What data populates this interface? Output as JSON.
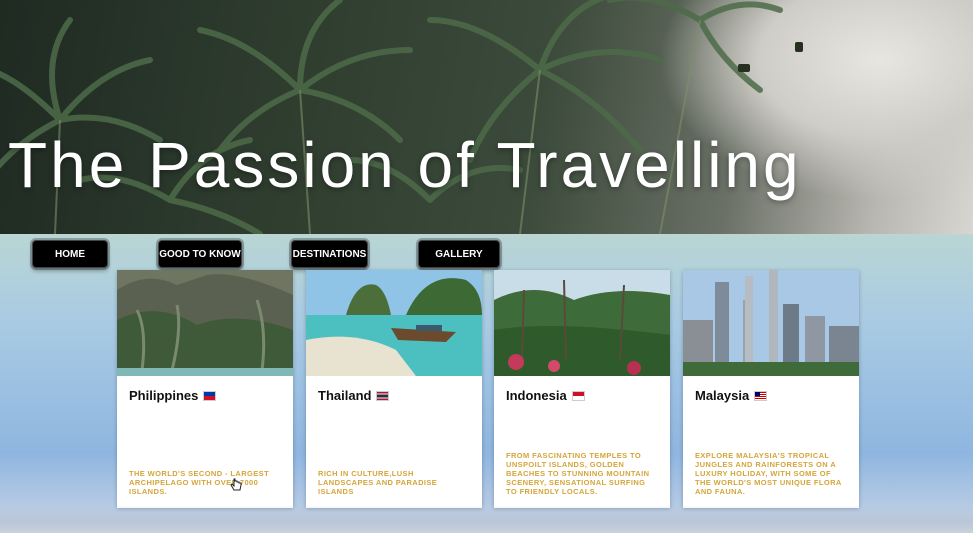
{
  "hero": {
    "title": "The Passion of Travelling"
  },
  "nav": {
    "items": [
      {
        "label": "HOME"
      },
      {
        "label": "GOOD TO KNOW"
      },
      {
        "label": "DESTINATIONS"
      },
      {
        "label": "GALLERY"
      }
    ]
  },
  "cards": [
    {
      "title": "Philippines",
      "flag": "philippines-flag-icon",
      "description": "The world's second - largest archipelago with over 7000 islands."
    },
    {
      "title": "Thailand",
      "flag": "thailand-flag-icon",
      "description": "Rich in culture,lush landscapes and paradise islands"
    },
    {
      "title": "Indonesia",
      "flag": "indonesia-flag-icon",
      "description": "From fascinating temples to unspoilt islands, golden beaches to stunning mountain scenery, sensational surfing to friendly locals."
    },
    {
      "title": "Malaysia",
      "flag": "malaysia-flag-icon",
      "description": "Explore Malaysia's tropical jungles and rainforests on a luxury holiday, with some of the world's most unique flora and fauna."
    }
  ],
  "colors": {
    "accent": "#d4a63a",
    "nav_bg": "#000000",
    "title": "#ffffff"
  }
}
